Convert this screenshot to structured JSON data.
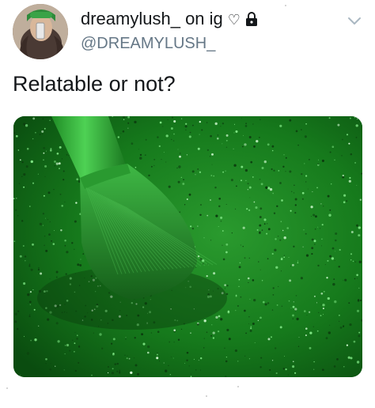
{
  "tweet": {
    "display_name": "dreamylush_ on ig",
    "heart_glyph": "♡",
    "handle": "@DREAMYLUSH_",
    "text": "Relatable or not?",
    "avatar_icon": "user-avatar-photo",
    "lock_icon": "lock-icon",
    "menu_icon": "chevron-down-icon",
    "media_icon": "green-glitter-makeup-brush-photo"
  },
  "colors": {
    "text_primary": "#14171a",
    "text_secondary": "#657786",
    "glitter_green": "#1f8a24",
    "brush_green": "#2fae35"
  }
}
